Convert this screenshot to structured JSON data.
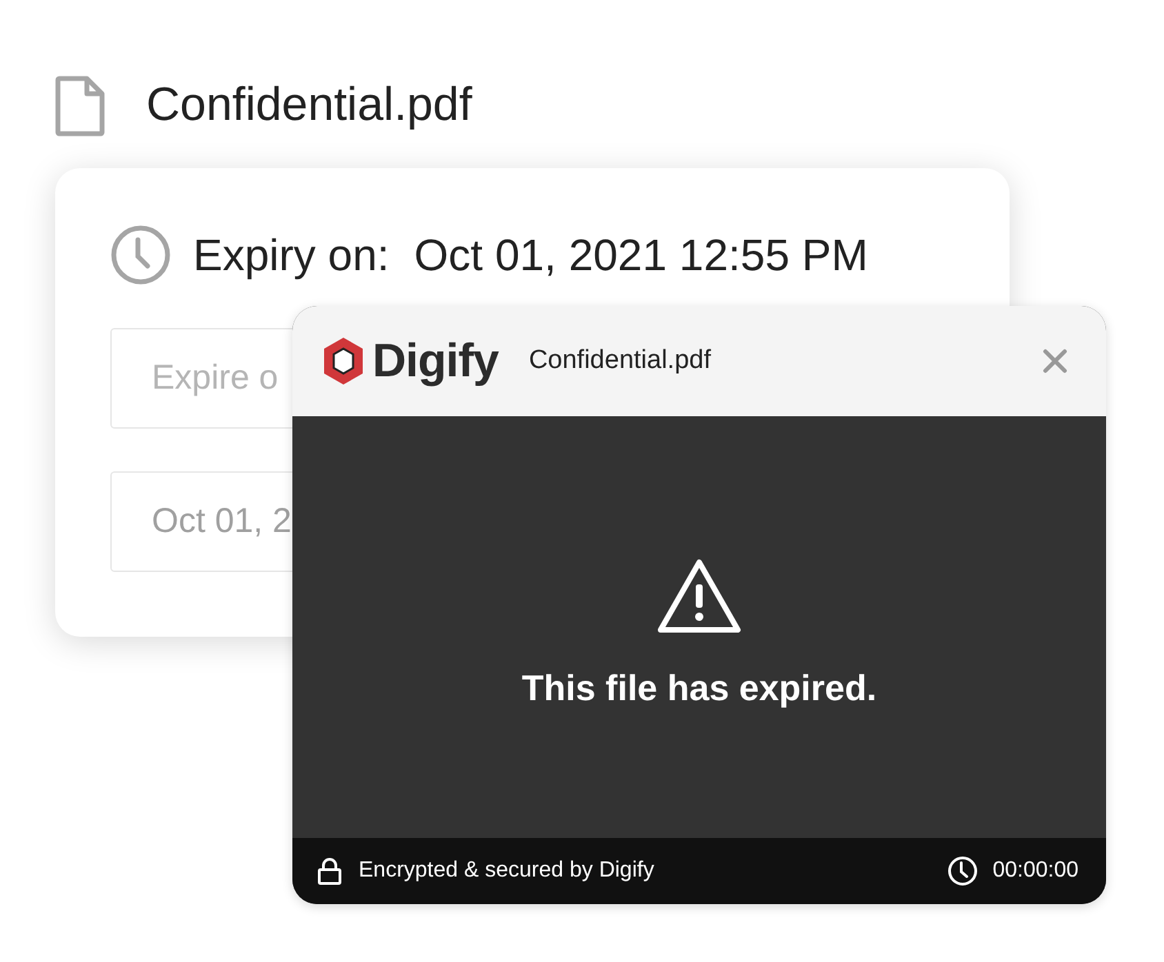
{
  "file": {
    "name": "Confidential.pdf"
  },
  "expiry_card": {
    "label": "Expiry on:",
    "value": "Oct 01, 2021 12:55 PM",
    "fields": [
      {
        "kind": "placeholder",
        "text": "Expire o"
      },
      {
        "kind": "value",
        "text": "Oct 01, 2"
      }
    ]
  },
  "viewer": {
    "brand": "Digify",
    "file_name": "Confidential.pdf",
    "message": "This file has expired.",
    "footer": {
      "security_note": "Encrypted & secured by Digify",
      "timer": "00:00:00"
    }
  }
}
